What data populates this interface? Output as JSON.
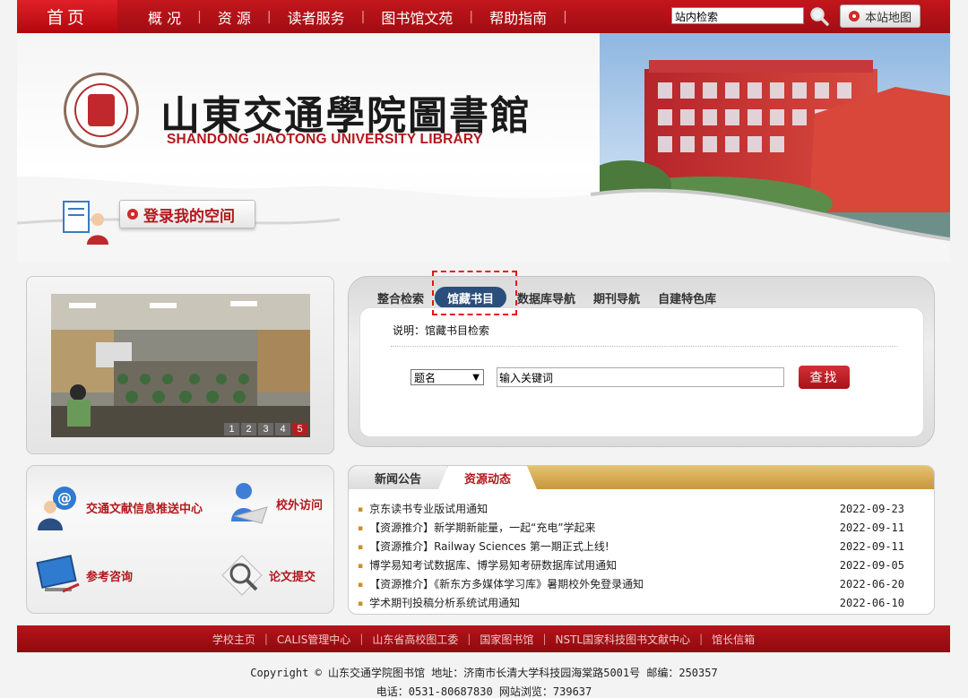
{
  "nav": {
    "home": "首页",
    "items": [
      "概 况",
      "资 源",
      "读者服务",
      "图书馆文苑",
      "帮助指南"
    ],
    "search_value": "站内检索",
    "sitemap_label": "本站地图"
  },
  "banner": {
    "title_cn": "山東交通學院圖書館",
    "title_en": "SHANDONG JIAOTONG UNIVERSITY LIBRARY",
    "login_label": "登录我的空间"
  },
  "slideshow": {
    "pages": [
      "1",
      "2",
      "3",
      "4",
      "5"
    ],
    "active_page": 5
  },
  "search": {
    "tabs": [
      "整合检索",
      "馆藏书目",
      "数据库导航",
      "期刊导航",
      "自建特色库"
    ],
    "active_tab": "馆藏书目",
    "description": "说明：馆藏书目检索",
    "field_selected": "题名",
    "keyword_value": "输入关键词",
    "submit_label": "查找"
  },
  "services": {
    "push_center": "交通文献信息推送中心",
    "offcampus": "校外访问",
    "reference": "参考咨询",
    "thesis": "论文提交"
  },
  "news": {
    "tab_news": "新闻公告",
    "tab_resources": "资源动态",
    "items": [
      {
        "title": "京东读书专业版试用通知",
        "date": "2022-09-23"
      },
      {
        "title": "【资源推介】新学期新能量，一起“充电”学起来",
        "date": "2022-09-11"
      },
      {
        "title": "【资源推介】Railway Sciences 第一期正式上线!",
        "date": "2022-09-11"
      },
      {
        "title": "博学易知考试数据库、博学易知考研数据库试用通知",
        "date": "2022-09-05"
      },
      {
        "title": "【资源推介】《新东方多媒体学习库》暑期校外免登录通知",
        "date": "2022-06-20"
      },
      {
        "title": "学术期刊投稿分析系统试用通知",
        "date": "2022-06-10"
      }
    ]
  },
  "footer": {
    "links": [
      "学校主页",
      "CALIS管理中心",
      "山东省高校图工委",
      "国家图书馆",
      "NSTL国家科技图书文献中心",
      "馆长信箱"
    ],
    "copyright": "Copyright © 山东交通学院图书馆 地址：济南市长清大学科技园海棠路5001号 邮编：250357",
    "contact": "电话：0531-80687830 网站浏览：739637"
  },
  "colors": {
    "brand_red": "#b2181d",
    "tab_blue": "#2a4f7c",
    "news_gold": "#c7983c"
  }
}
